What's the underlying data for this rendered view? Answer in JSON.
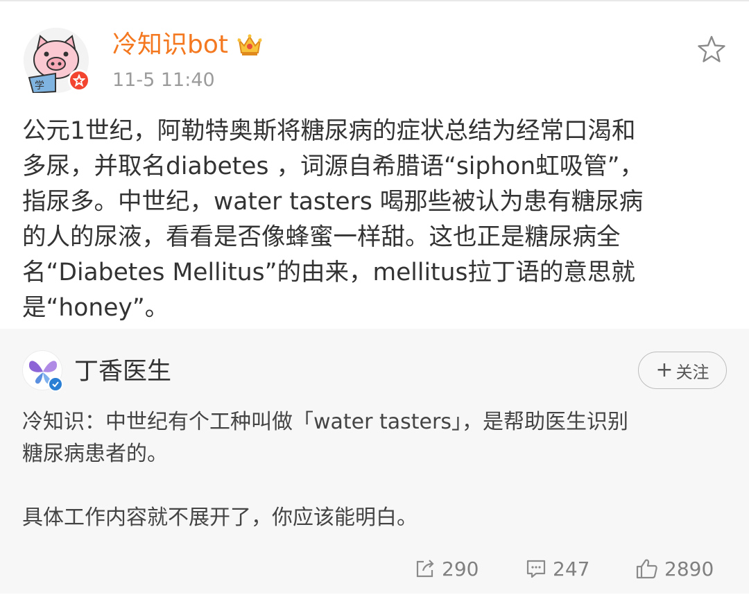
{
  "post": {
    "author": "冷知识bot",
    "author_color": "#f4781f",
    "author_badge": "crown-icon",
    "time": "11-5 11:40",
    "favorite_icon": "star-icon",
    "body": "公元1世纪，阿勒特奥斯将糖尿病的症状总结为经常口渴和\n多尿，并取名diabetes ，词源自希腊语“siphon虹吸管”，\n指尿多。中世纪，water tasters 喝那些被认为患有糖尿病\n的人的尿液，看看是否像蜂蜜一样甜。这也正是糖尿病全\n名“Diabetes Mellitus”的由来，mellitus拉丁语的意思就\n是“honey”。"
  },
  "repost": {
    "author": "丁香医生",
    "follow_label": "关注",
    "follow_plus": "+",
    "body_line1": "冷知识：中世纪有个工种叫做「water tasters」，是帮助医生识别\n糖尿病患者的。",
    "body_line2": "具体工作内容就不展开了，你应该能明白。",
    "verified_color": "#2a7fd4"
  },
  "actions": {
    "reposts": "290",
    "comments": "247",
    "likes": "2890"
  }
}
